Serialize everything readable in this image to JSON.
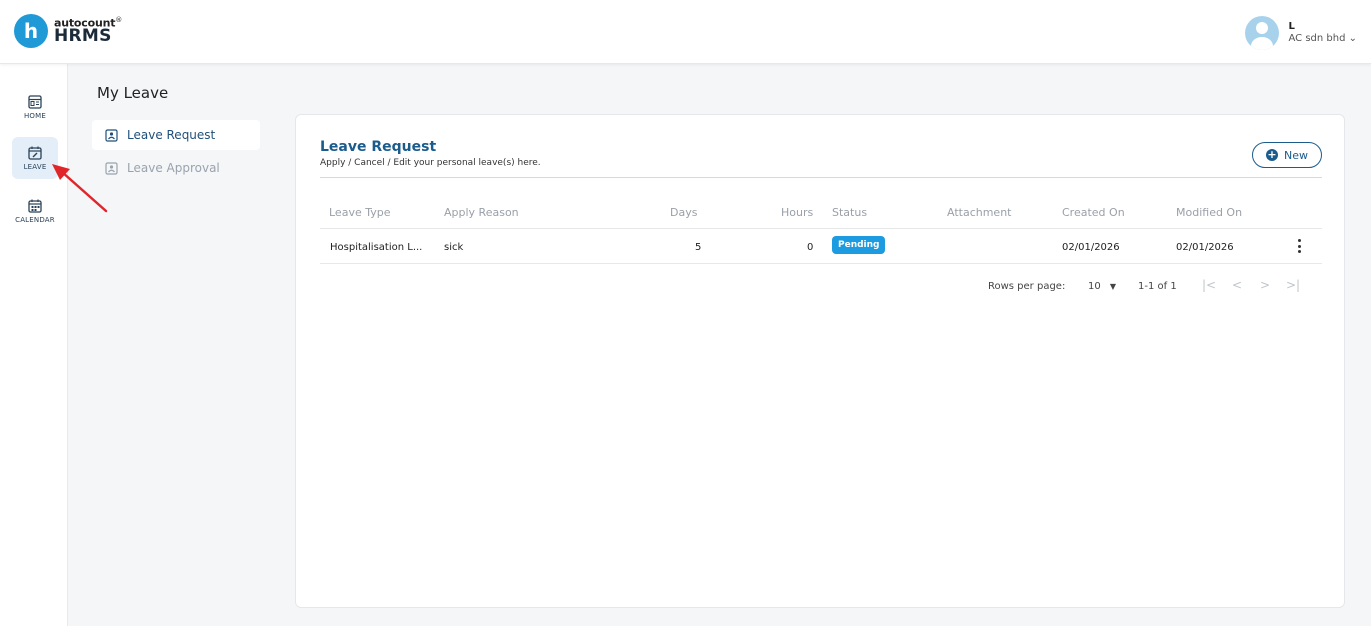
{
  "brand": {
    "small": "autocount",
    "reg": "®",
    "big": "HRMS",
    "mark": "h",
    "color": "#1f9ad6"
  },
  "user": {
    "name": "L",
    "company": "AC sdn bhd ⌄"
  },
  "rail": [
    {
      "label": "HOME",
      "icon": "home-icon"
    },
    {
      "label": "LEAVE",
      "icon": "leave-calendar-icon",
      "active": true
    },
    {
      "label": "CALENDAR",
      "icon": "calendar-icon"
    }
  ],
  "page": {
    "title": "My Leave"
  },
  "subnav": [
    {
      "label": "Leave Request",
      "active": true
    },
    {
      "label": "Leave Approval",
      "active": false
    }
  ],
  "card": {
    "title": "Leave Request",
    "subtitle": "Apply / Cancel / Edit your personal leave(s) here.",
    "new_label": "New",
    "new_icon": "plus-circle-icon"
  },
  "table": {
    "columns": [
      "Leave Type",
      "Apply Reason",
      "Days",
      "Hours",
      "Status",
      "Attachment",
      "Created On",
      "Modified On"
    ],
    "rows": [
      {
        "leave_type": "Hospitalisation L...",
        "reason": "sick",
        "days": "5",
        "hours": "0",
        "status": "Pending",
        "attachment": "",
        "created": "02/01/2026",
        "modified": "02/01/2026"
      }
    ]
  },
  "pagination": {
    "rows_label": "Rows per page:",
    "rows_value": "10",
    "range": "1-1 of 1",
    "first": "|<",
    "prev": "<",
    "next": ">",
    "last": ">|"
  },
  "colors": {
    "accent": "#1b5c8c",
    "badge": "#1d9be0",
    "arrow": "#e0262b"
  }
}
